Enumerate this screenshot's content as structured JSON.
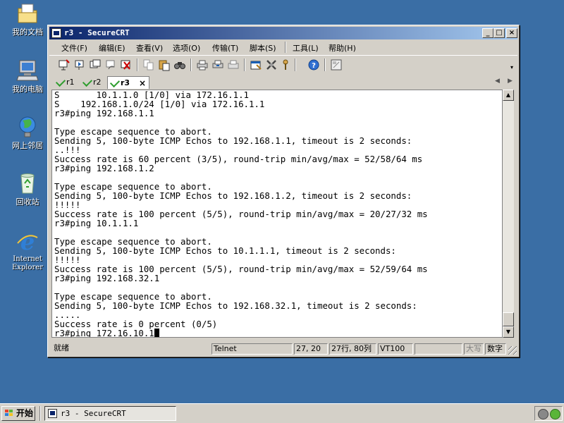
{
  "desktop": {
    "icons": [
      {
        "label": "我的文档",
        "icon": "my-documents-icon"
      },
      {
        "label": "我的电脑",
        "icon": "my-computer-icon"
      },
      {
        "label": "网上邻居",
        "icon": "network-places-icon"
      },
      {
        "label": "回收站",
        "icon": "recycle-bin-icon"
      },
      {
        "label": "Internet\nExplorer",
        "icon": "internet-explorer-icon"
      }
    ]
  },
  "window": {
    "title": "r3 - SecureCRT",
    "controls": {
      "minimize": "_",
      "maximize": "□",
      "close": "×"
    },
    "menu": [
      "文件(F)",
      "编辑(E)",
      "查看(V)",
      "选项(O)",
      "传输(T)",
      "脚本(S)",
      "工具(L)",
      "帮助(H)"
    ],
    "tabs": [
      {
        "label": "r1",
        "active": false
      },
      {
        "label": "r2",
        "active": false
      },
      {
        "label": "r3",
        "active": true
      }
    ],
    "tab_close": "×",
    "tab_nav": {
      "left": "◀",
      "right": "▶"
    }
  },
  "terminal": {
    "lines": [
      "S       10.1.1.0 [1/0] via 172.16.1.1",
      "S    192.168.1.0/24 [1/0] via 172.16.1.1",
      "r3#ping 192.168.1.1",
      "",
      "Type escape sequence to abort.",
      "Sending 5, 100-byte ICMP Echos to 192.168.1.1, timeout is 2 seconds:",
      "..!!!",
      "Success rate is 60 percent (3/5), round-trip min/avg/max = 52/58/64 ms",
      "r3#ping 192.168.1.2",
      "",
      "Type escape sequence to abort.",
      "Sending 5, 100-byte ICMP Echos to 192.168.1.2, timeout is 2 seconds:",
      "!!!!!",
      "Success rate is 100 percent (5/5), round-trip min/avg/max = 20/27/32 ms",
      "r3#ping 10.1.1.1",
      "",
      "Type escape sequence to abort.",
      "Sending 5, 100-byte ICMP Echos to 10.1.1.1, timeout is 2 seconds:",
      "!!!!!",
      "Success rate is 100 percent (5/5), round-trip min/avg/max = 52/59/64 ms",
      "r3#ping 192.168.32.1",
      "",
      "Type escape sequence to abort.",
      "Sending 5, 100-byte ICMP Echos to 192.168.32.1, timeout is 2 seconds:",
      ".....",
      "Success rate is 0 percent (0/5)"
    ],
    "current_input": "r3#ping 172.16.10.1"
  },
  "statusbar": {
    "status": "就绪",
    "protocol": "Telnet",
    "position": "27, 20",
    "size": "27行, 80列",
    "emulation": "VT100",
    "caps": "大写",
    "num": "数字"
  },
  "taskbar": {
    "start_label": "开始",
    "task_label": "r3 - SecureCRT"
  },
  "colors": {
    "desktop": "#3a6ea5",
    "titlebar_start": "#0a246a",
    "titlebar_end": "#a6caf0",
    "tab_check": "#2f9e2f"
  }
}
